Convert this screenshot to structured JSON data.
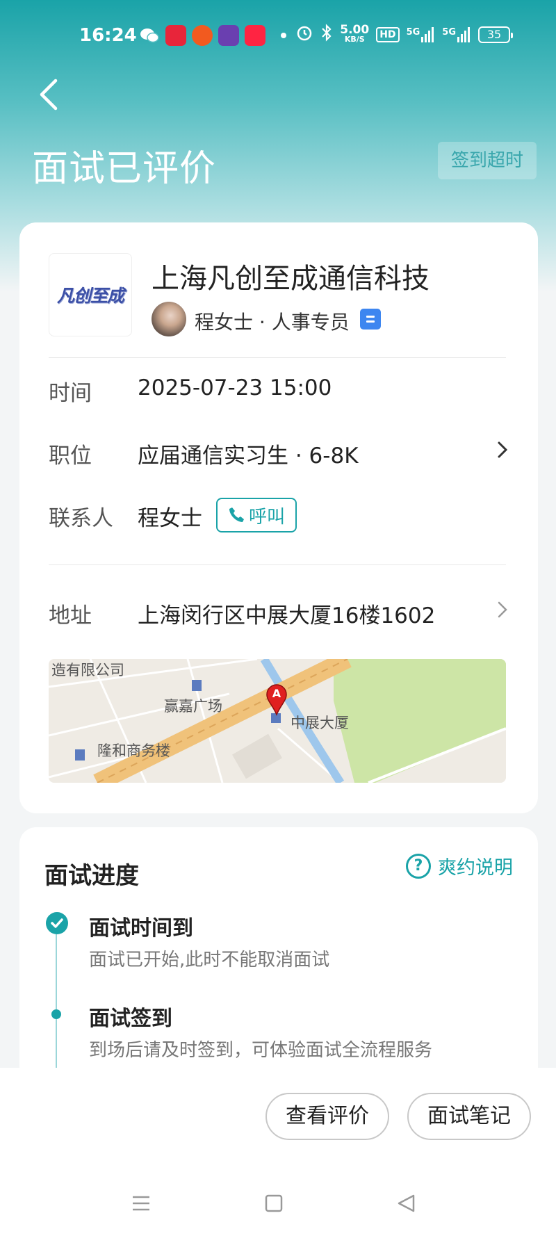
{
  "status_bar": {
    "time": "16:24",
    "net_speed_value": "5.00",
    "net_speed_unit": "KB/S",
    "hd": "HD",
    "signal1": "5G",
    "signal2": "5G",
    "battery": "35"
  },
  "header": {
    "title": "面试已评价",
    "timeout_tag": "签到超时"
  },
  "company": {
    "logo_text": "凡创至成",
    "name": "上海凡创至成通信科技",
    "hr_info": "程女士 · 人事专员"
  },
  "details": {
    "time_label": "时间",
    "time_value": "2025-07-23 15:00",
    "position_label": "职位",
    "position_value": "应届通信实习生 · 6-8K",
    "contact_label": "联系人",
    "contact_value": "程女士",
    "call_label": "呼叫",
    "address_label": "地址",
    "address_value": "上海闵行区中展大厦16楼1602"
  },
  "map": {
    "label_top": "造有限公司",
    "label_plaza": "赢嘉广场",
    "label_target": "中展大厦",
    "label_longhe": "隆和商务楼",
    "pin_letter": "A"
  },
  "progress": {
    "title": "面试进度",
    "help_label": "爽约说明",
    "steps": [
      {
        "title": "面试时间到",
        "desc": "面试已开始,此时不能取消面试"
      },
      {
        "title": "面试签到",
        "desc": "到场后请及时签到，可体验面试全流程服务"
      }
    ]
  },
  "actions": {
    "view_review": "查看评价",
    "notes": "面试笔记"
  },
  "colors": {
    "accent": "#1aa3a8",
    "badge_blue": "#3d86f0"
  }
}
